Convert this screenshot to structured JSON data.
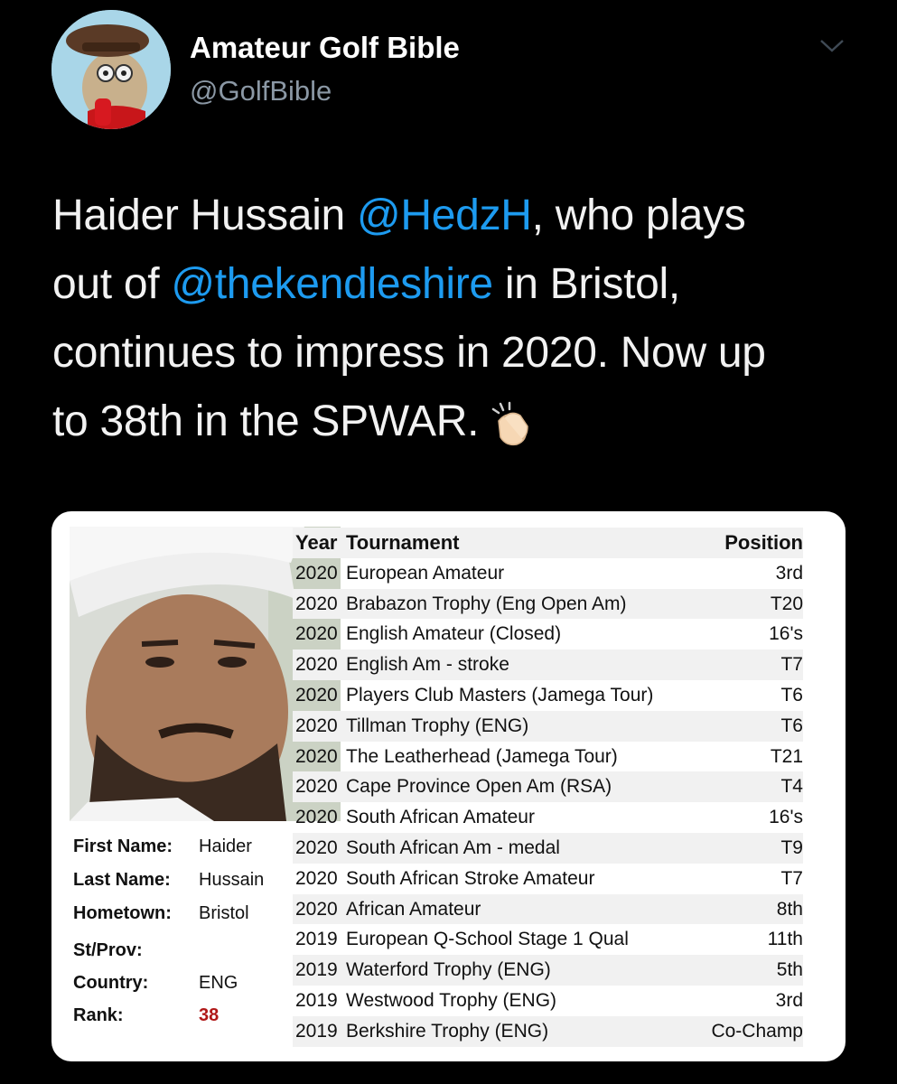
{
  "author": {
    "display_name": "Amateur Golf Bible",
    "handle": "@GolfBible"
  },
  "tweet": {
    "lines": [
      [
        {
          "t": "Haider Hussain ",
          "m": false
        },
        {
          "t": "@HedzH",
          "m": true
        },
        {
          "t": ", who plays",
          "m": false
        }
      ],
      [
        {
          "t": "out of ",
          "m": false
        },
        {
          "t": "@thekendleshire",
          "m": true
        },
        {
          "t": " in Bristol,",
          "m": false
        }
      ],
      [
        {
          "t": "continues to impress in 2020. Now up",
          "m": false
        }
      ],
      [
        {
          "t": "to 38th in the SPWAR.",
          "m": false
        }
      ]
    ],
    "emoji": "clapping-hands-icon"
  },
  "profile": {
    "first_name_label": "First Name:",
    "first_name": "Haider",
    "last_name_label": "Last Name:",
    "last_name": "Hussain",
    "hometown_label": "Hometown:",
    "hometown": "Bristol",
    "stprov_label": "St/Prov:",
    "stprov": "",
    "country_label": "Country:",
    "country": "ENG",
    "rank_label": "Rank:",
    "rank": "38"
  },
  "results": {
    "headers": {
      "year": "Year",
      "tournament": "Tournament",
      "position": "Position"
    },
    "rows": [
      {
        "year": "2020",
        "tournament": "European Amateur",
        "position": "3rd"
      },
      {
        "year": "2020",
        "tournament": "Brabazon Trophy (Eng Open Am)",
        "position": "T20"
      },
      {
        "year": "2020",
        "tournament": "English Amateur (Closed)",
        "position": "16's"
      },
      {
        "year": "2020",
        "tournament": "English Am - stroke",
        "position": "T7"
      },
      {
        "year": "2020",
        "tournament": "Players Club Masters (Jamega Tour)",
        "position": "T6"
      },
      {
        "year": "2020",
        "tournament": "Tillman Trophy (ENG)",
        "position": "T6"
      },
      {
        "year": "2020",
        "tournament": "The Leatherhead (Jamega Tour)",
        "position": "T21"
      },
      {
        "year": "2020",
        "tournament": "Cape Province Open Am (RSA)",
        "position": "T4"
      },
      {
        "year": "2020",
        "tournament": "South African Amateur",
        "position": "16's"
      },
      {
        "year": "2020",
        "tournament": "South African Am - medal",
        "position": "T9"
      },
      {
        "year": "2020",
        "tournament": "South African Stroke Amateur",
        "position": "T7"
      },
      {
        "year": "2020",
        "tournament": "African Amateur",
        "position": "8th"
      },
      {
        "year": "2019",
        "tournament": "European Q-School Stage 1 Qual",
        "position": "11th"
      },
      {
        "year": "2019",
        "tournament": "Waterford Trophy (ENG)",
        "position": "5th"
      },
      {
        "year": "2019",
        "tournament": "Westwood Trophy (ENG)",
        "position": "3rd"
      },
      {
        "year": "2019",
        "tournament": "Berkshire Trophy (ENG)",
        "position": "Co-Champ"
      }
    ]
  },
  "colors": {
    "background": "#000000",
    "mention": "#1d9bf0",
    "handle": "#8b98a5",
    "rank": "#b01818"
  }
}
